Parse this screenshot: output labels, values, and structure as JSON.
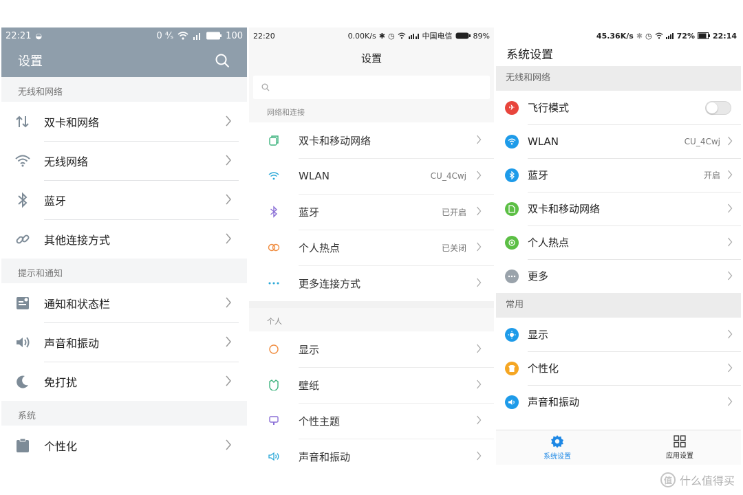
{
  "panel1": {
    "status": {
      "time": "22:21",
      "data_speed": "0 ⁴⁄ₛ",
      "battery": "100"
    },
    "title": "设置",
    "sections": [
      {
        "header": "无线和网络",
        "items": [
          {
            "label": "双卡和网络",
            "icon": "dual-sim-arrows-icon"
          },
          {
            "label": "无线网络",
            "icon": "wifi-icon"
          },
          {
            "label": "蓝牙",
            "icon": "bluetooth-icon"
          },
          {
            "label": "其他连接方式",
            "icon": "link-icon"
          }
        ]
      },
      {
        "header": "提示和通知",
        "items": [
          {
            "label": "通知和状态栏",
            "icon": "notification-bar-icon"
          },
          {
            "label": "声音和振动",
            "icon": "speaker-icon"
          },
          {
            "label": "免打扰",
            "icon": "moon-icon"
          }
        ]
      },
      {
        "header": "系统",
        "items": [
          {
            "label": "个性化",
            "icon": "personalize-icon"
          }
        ]
      }
    ]
  },
  "panel2": {
    "status": {
      "time": "22:20",
      "speed": "0.00K/s",
      "carrier": "中国电信",
      "battery": "89%"
    },
    "title": "设置",
    "sections": [
      {
        "header": "网络和连接",
        "items": [
          {
            "label": "双卡和移动网络",
            "value": "",
            "icon": "sim-card-icon"
          },
          {
            "label": "WLAN",
            "value": "CU_4Cwj",
            "icon": "wifi-icon"
          },
          {
            "label": "蓝牙",
            "value": "已开启",
            "icon": "bluetooth-icon"
          },
          {
            "label": "个人热点",
            "value": "已关闭",
            "icon": "hotspot-icon"
          },
          {
            "label": "更多连接方式",
            "value": "",
            "icon": "more-dots-icon"
          }
        ]
      },
      {
        "header": "个人",
        "items": [
          {
            "label": "显示",
            "value": "",
            "icon": "display-icon"
          },
          {
            "label": "壁纸",
            "value": "",
            "icon": "wallpaper-icon"
          },
          {
            "label": "个性主题",
            "value": "",
            "icon": "theme-icon"
          },
          {
            "label": "声音和振动",
            "value": "",
            "icon": "speaker-icon"
          }
        ]
      }
    ]
  },
  "panel3": {
    "status": {
      "speed": "45.36K/s",
      "battery": "72%",
      "time": "22:14"
    },
    "title": "系统设置",
    "sections": [
      {
        "header": "无线和网络",
        "items": [
          {
            "label": "飞行模式",
            "value": "",
            "toggle": true,
            "icon": "airplane-icon",
            "color": "#e8453c"
          },
          {
            "label": "WLAN",
            "value": "CU_4Cwj",
            "icon": "wifi-icon",
            "color": "#1e9be9"
          },
          {
            "label": "蓝牙",
            "value": "开启",
            "icon": "bluetooth-icon",
            "color": "#1e9be9"
          },
          {
            "label": "双卡和移动网络",
            "value": "",
            "icon": "sim-card-icon",
            "color": "#5cbf45"
          },
          {
            "label": "个人热点",
            "value": "",
            "icon": "hotspot-icon",
            "color": "#5cbf45"
          },
          {
            "label": "更多",
            "value": "",
            "icon": "more-dots-icon",
            "color": "#9aa3ab"
          }
        ]
      },
      {
        "header": "常用",
        "items": [
          {
            "label": "显示",
            "value": "",
            "icon": "display-icon",
            "color": "#1e9be9"
          },
          {
            "label": "个性化",
            "value": "",
            "icon": "personalize-icon",
            "color": "#f5a623"
          },
          {
            "label": "声音和振动",
            "value": "",
            "icon": "speaker-icon",
            "color": "#1e9be9"
          }
        ]
      }
    ],
    "nav": [
      {
        "label": "系统设置",
        "icon": "gear-icon",
        "active": true
      },
      {
        "label": "应用设置",
        "icon": "grid-icon",
        "active": false
      }
    ]
  },
  "watermark": {
    "text": "什么值得买",
    "logo_char": "值"
  }
}
